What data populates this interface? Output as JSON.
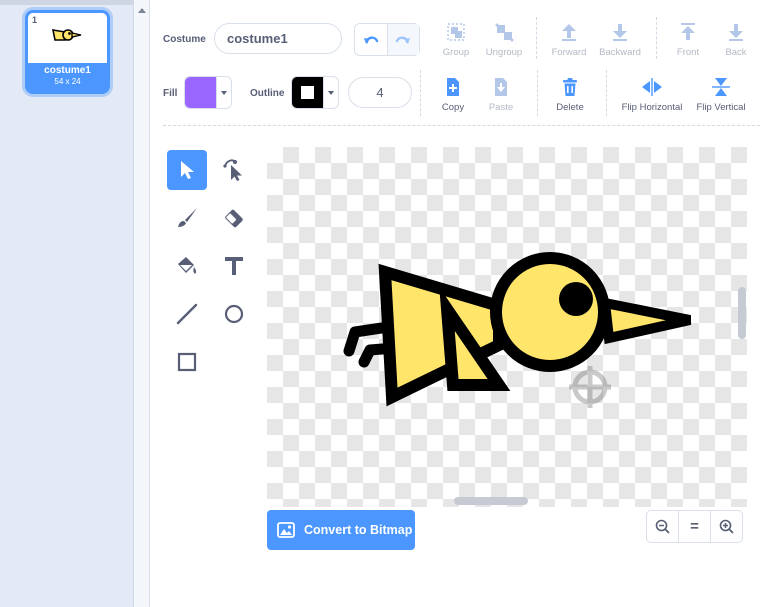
{
  "costume_list": {
    "items": [
      {
        "number": "1",
        "name": "costume1",
        "size": "54 x 24",
        "selected": true
      }
    ]
  },
  "toolbar": {
    "costume_label": "Costume",
    "costume_name": "costume1",
    "fill_label": "Fill",
    "fill_color": "#9966ff",
    "outline_label": "Outline",
    "outline_color": "#000000",
    "outline_width": "4",
    "group_label": "Group",
    "ungroup_label": "Ungroup",
    "forward_label": "Forward",
    "backward_label": "Backward",
    "front_label": "Front",
    "back_label": "Back",
    "copy_label": "Copy",
    "paste_label": "Paste",
    "delete_label": "Delete",
    "flip_horizontal_label": "Flip Horizontal",
    "flip_vertical_label": "Flip Vertical"
  },
  "tools": [
    "select-icon",
    "reshape-icon",
    "brush-icon",
    "eraser-icon",
    "fill-icon",
    "text-icon",
    "line-icon",
    "circle-icon",
    "rectangle-icon"
  ],
  "active_tool": "select",
  "canvas": {
    "convert_label": "Convert to Bitmap",
    "bird_fill": "#ffe66b",
    "bird_outline": "#000000"
  },
  "zoom": {
    "reset_label": "="
  },
  "colors": {
    "accent": "#4c97ff",
    "text": "#575e75",
    "disabled": "#b3b9c4"
  }
}
